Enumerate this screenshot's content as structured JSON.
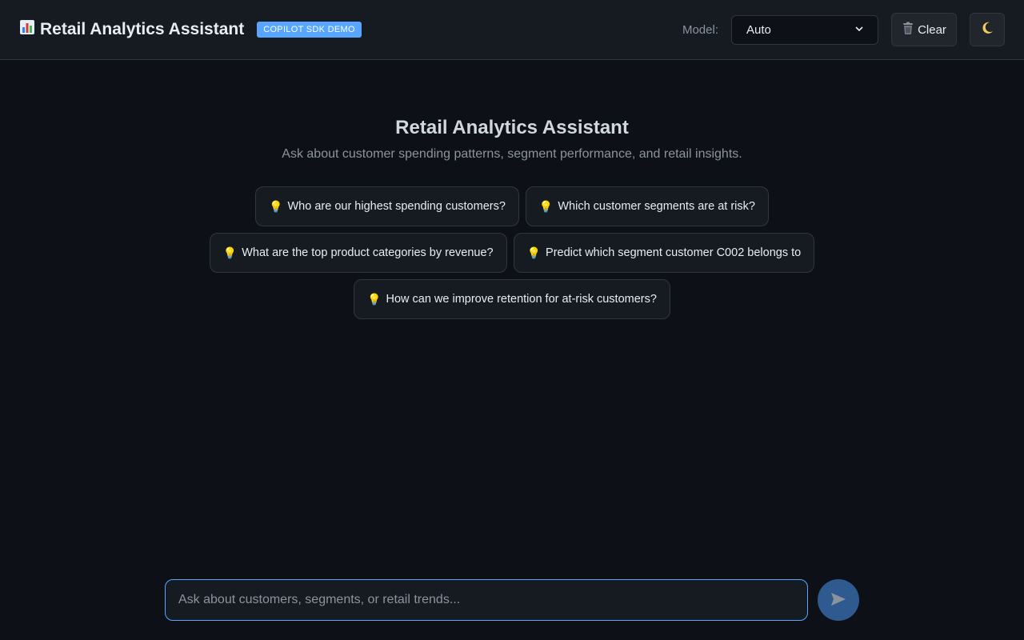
{
  "header": {
    "logo_icon": "bar-chart-icon",
    "title": "Retail Analytics Assistant",
    "badge": "COPILOT SDK DEMO",
    "model_label": "Model:",
    "model_selected": "Auto",
    "clear_label": "Clear",
    "clear_icon": "trash-icon",
    "theme_icon": "moon-icon"
  },
  "welcome": {
    "title": "Retail Analytics Assistant",
    "subtitle": "Ask about customer spending patterns, segment performance, and retail insights."
  },
  "suggestions": [
    "Who are our highest spending customers?",
    "Which customer segments are at risk?",
    "What are the top product categories by revenue?",
    "Predict which segment customer C002 belongs to",
    "How can we improve retention for at-risk customers?"
  ],
  "composer": {
    "placeholder": "Ask about customers, segments, or retail trends...",
    "value": "",
    "send_icon": "send-icon"
  },
  "colors": {
    "background": "#0d1117",
    "surface": "#161b22",
    "border": "#30363d",
    "accent": "#58a6ff",
    "send_button": "#2f5a8f"
  }
}
